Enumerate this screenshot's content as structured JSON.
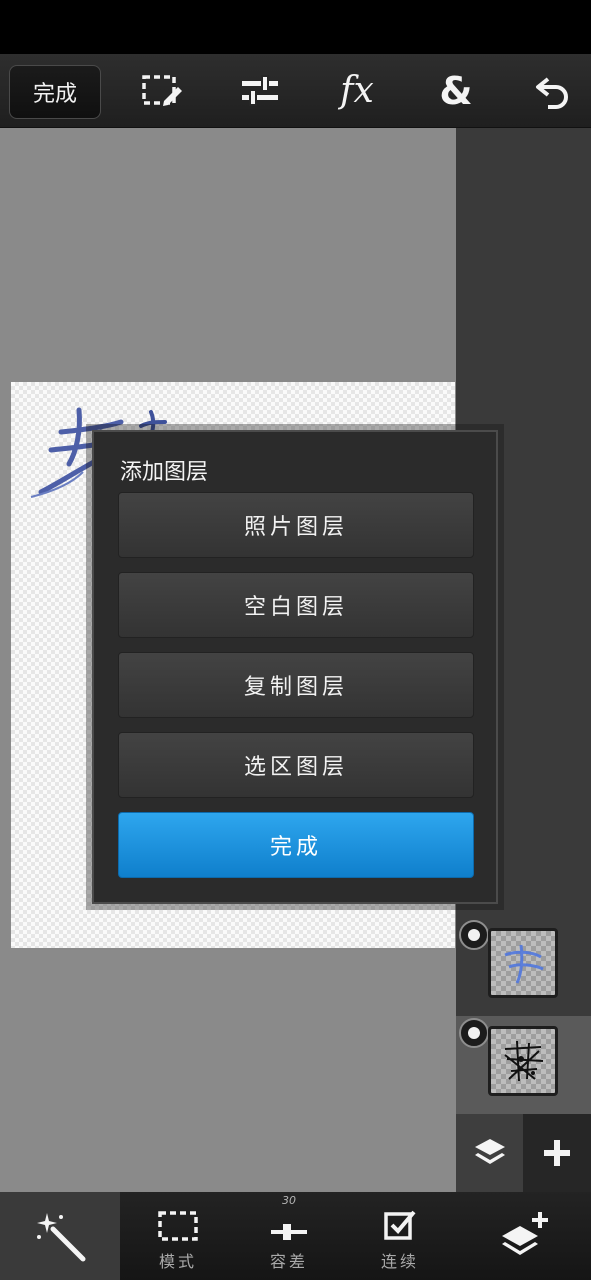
{
  "top_toolbar": {
    "done_label": "完成",
    "icons": [
      "selection-edit-icon",
      "adjustments-icon",
      "fx-icon",
      "blend-icon",
      "undo-icon"
    ],
    "fx_label": "fx",
    "amp_label": "&"
  },
  "dialog": {
    "title": "添加图层",
    "options": [
      {
        "label": "照片图层"
      },
      {
        "label": "空白图层"
      },
      {
        "label": "复制图层"
      },
      {
        "label": "选区图层"
      }
    ],
    "done_label": "完成"
  },
  "bottom_toolbar": {
    "tools": [
      {
        "label": "模式",
        "icon": "marquee-icon"
      },
      {
        "label": "容差",
        "icon": "tolerance-slider-icon",
        "value": "30"
      },
      {
        "label": "连续",
        "icon": "checkbox-icon"
      }
    ]
  },
  "colors": {
    "accent": "#1a8fdd",
    "toolbar": "#262626",
    "workspace": "#8a8a8a"
  }
}
